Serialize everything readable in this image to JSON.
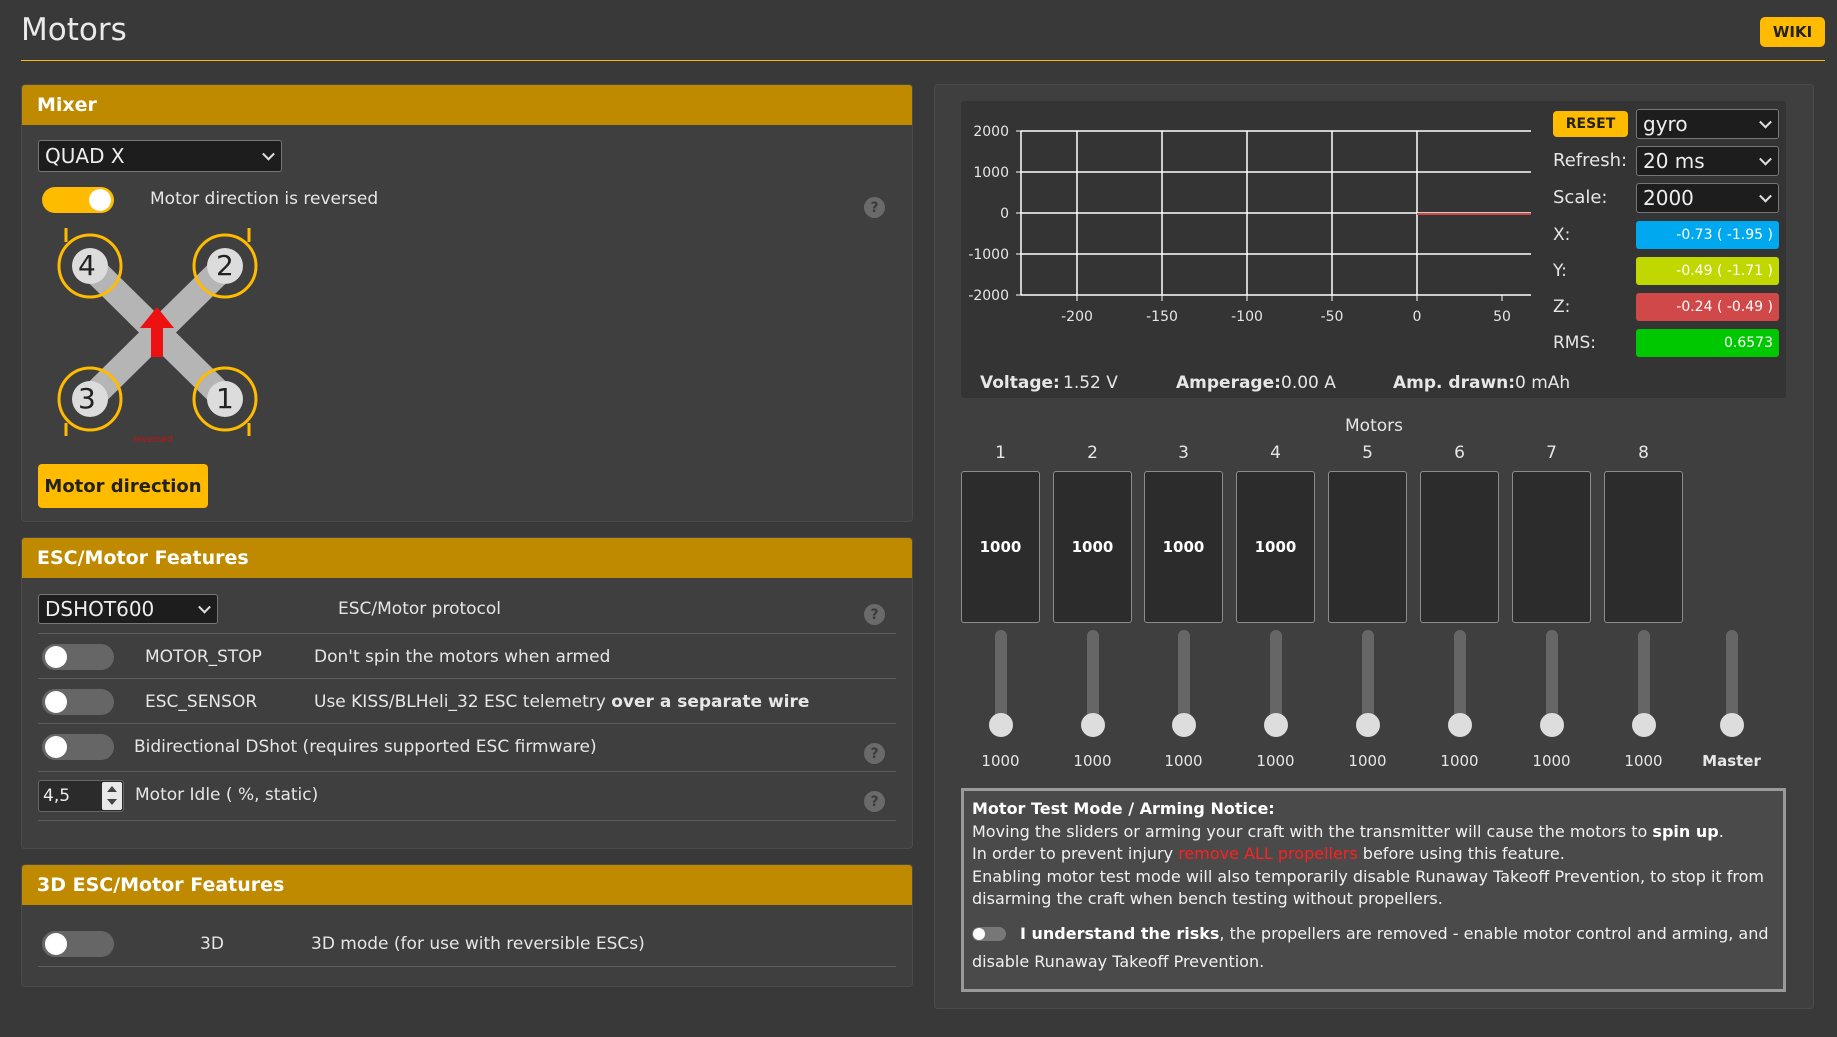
{
  "header": {
    "title": "Motors",
    "wiki_label": "WIKI"
  },
  "mixer": {
    "title": "Mixer",
    "type_value": "QUAD X",
    "reverse_label": "Motor direction is reversed",
    "reverse_on": true,
    "motor_labels": [
      "4",
      "2",
      "3",
      "1"
    ],
    "reversed_caption": "reversed",
    "direction_button": "Motor direction"
  },
  "esc": {
    "title": "ESC/Motor Features",
    "protocol_value": "DSHOT600",
    "protocol_label": "ESC/Motor protocol",
    "motor_stop": {
      "name": "MOTOR_STOP",
      "desc": "Don't spin the motors when armed"
    },
    "esc_sensor": {
      "name": "ESC_SENSOR",
      "desc_start": "Use KISS/BLHeli_32 ESC telemetry ",
      "desc_bold": "over a separate wire"
    },
    "bidir_label": "Bidirectional DShot (requires supported ESC firmware)",
    "idle_value": "4,5",
    "idle_label": "Motor Idle ( %, static)"
  },
  "esc3d": {
    "title": "3D ESC/Motor Features",
    "name": "3D",
    "desc": "3D mode (for use with reversible ESCs)"
  },
  "sensor": {
    "reset_label": "RESET",
    "sensor_value": "gyro",
    "refresh_label": "Refresh:",
    "refresh_value": "20 ms",
    "scale_label": "Scale:",
    "scale_value": "2000",
    "x_label": "X:",
    "x_value": "-0.73 ( -1.95 )",
    "y_label": "Y:",
    "y_value": "-0.49 ( -1.71 )",
    "z_label": "Z:",
    "z_value": "-0.24 ( -0.49 )",
    "rms_label": "RMS:",
    "rms_value": "0.6573",
    "colors": {
      "x": "#00a8f0",
      "y": "#c0d800",
      "z": "#d04848",
      "rms": "#00c800"
    }
  },
  "graph": {
    "y_ticks": [
      "2000",
      "1000",
      "0",
      "-1000",
      "-2000"
    ],
    "x_ticks": [
      "-200",
      "-150",
      "-100",
      "-50",
      "0",
      "50"
    ]
  },
  "power": {
    "voltage_label": "Voltage:",
    "voltage_value": "1.52 V",
    "amperage_label": "Amperage:",
    "amperage_value": "0.00 A",
    "drawn_label": "Amp. drawn:",
    "drawn_value": "0 mAh"
  },
  "motors": {
    "title": "Motors",
    "numbers": [
      "1",
      "2",
      "3",
      "4",
      "5",
      "6",
      "7",
      "8"
    ],
    "bar_values": [
      "1000",
      "1000",
      "1000",
      "1000",
      "",
      "",
      "",
      ""
    ],
    "slider_values": [
      "1000",
      "1000",
      "1000",
      "1000",
      "1000",
      "1000",
      "1000",
      "1000"
    ],
    "master_label": "Master"
  },
  "notice": {
    "title": "Motor Test Mode / Arming Notice:",
    "line1_start": "Moving the sliders or arming your craft with the transmitter will cause the motors to ",
    "line1_bold": "spin up",
    "line1_end": ".",
    "line2_start": "In order to prevent injury ",
    "line2_red": "remove ALL propellers",
    "line2_end": " before using this feature.",
    "line3": "Enabling motor test mode will also temporarily disable Runaway Takeoff Prevention, to stop it from disarming the craft when bench testing without propellers.",
    "understand_bold": "I understand the risks",
    "understand_rest": ", the propellers are removed - enable motor control and arming, and disable Runaway Takeoff Prevention."
  }
}
